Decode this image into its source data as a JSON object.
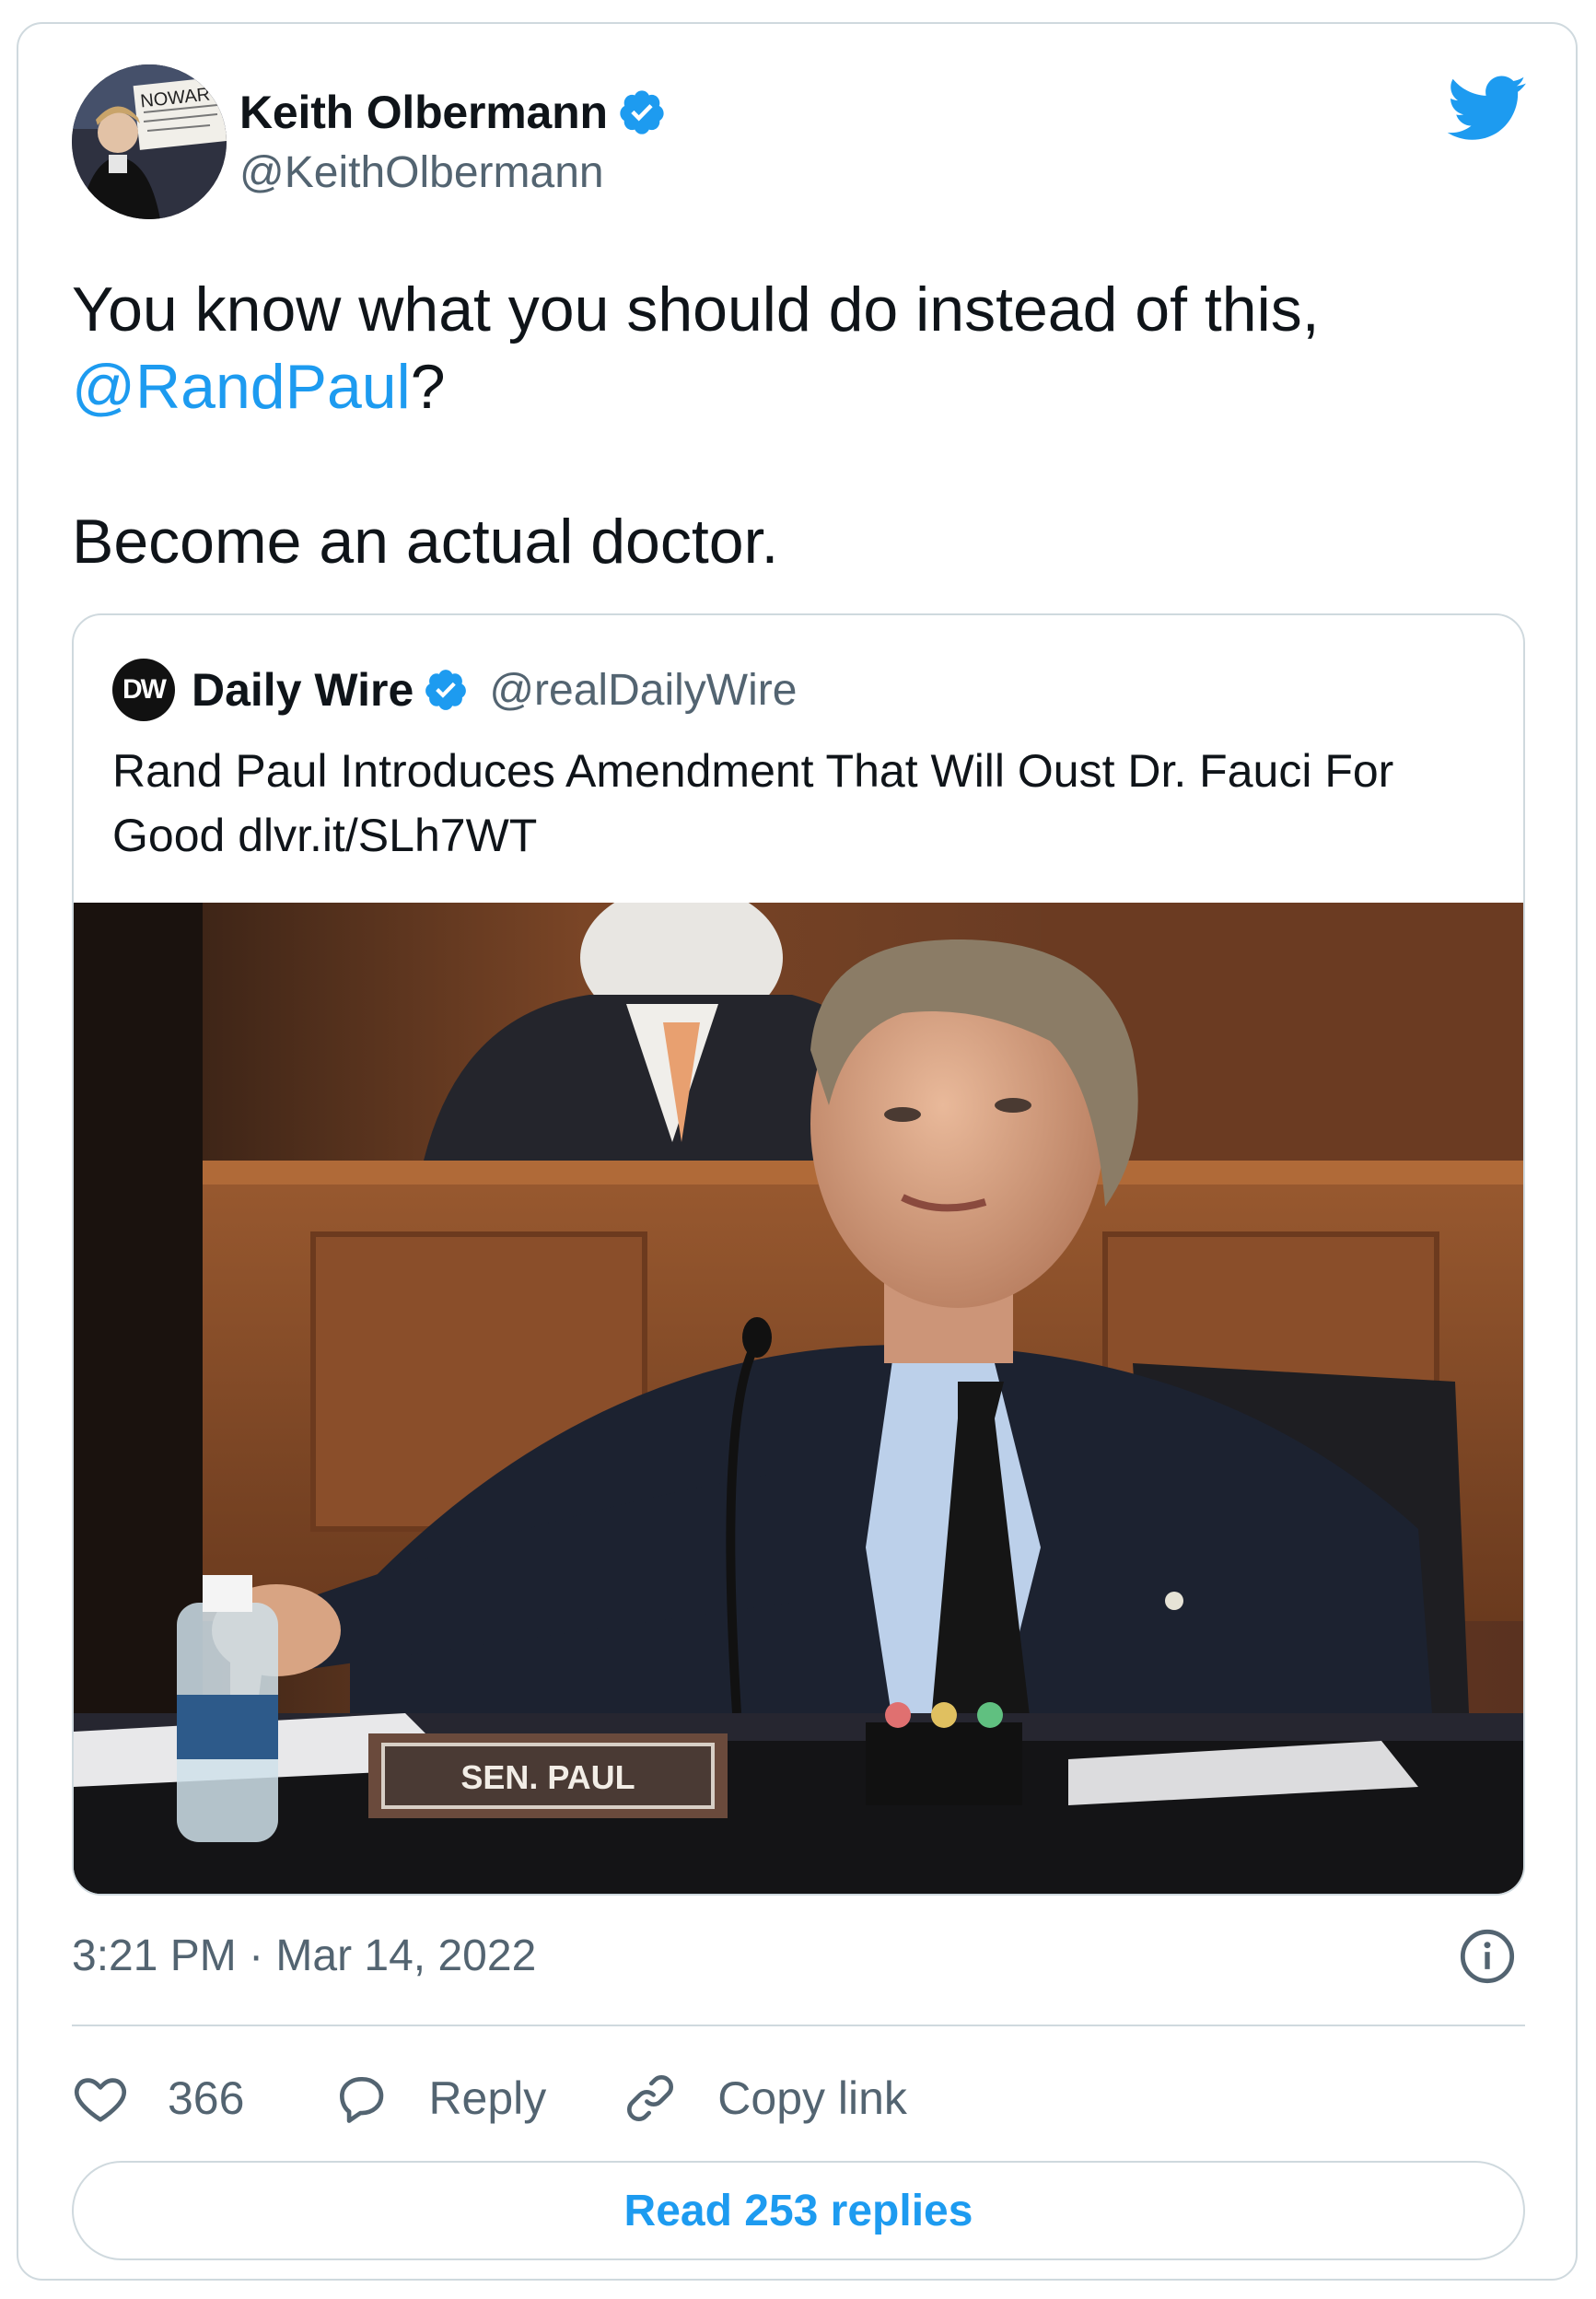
{
  "author": {
    "name": "Keith Olbermann",
    "handle": "@KeithOlbermann",
    "avatar_sign_text": "NOWAR"
  },
  "tweet": {
    "line1": "You know what you should do instead of this,",
    "mention": "@RandPaul",
    "mention_suffix": "?",
    "line3": "Become an actual doctor."
  },
  "quote": {
    "logo_text": "DW",
    "name": "Daily Wire",
    "handle": "@realDailyWire",
    "text": "Rand Paul Introduces Amendment That Will Oust Dr. Fauci For Good dlvr.it/SLh7WT",
    "image": {
      "nameplate": "SEN. PAUL"
    }
  },
  "footer": {
    "timestamp": "3:21 PM · Mar 14, 2022",
    "like_count": "366",
    "reply_label": "Reply",
    "copy_label": "Copy link",
    "read_replies": "Read 253 replies"
  },
  "colors": {
    "accent": "#1d9bf0",
    "text": "#0f1419",
    "muted": "#536471",
    "border": "#cfd9de"
  },
  "icons": [
    "twitter-bird-icon",
    "verified-badge-icon",
    "info-icon",
    "heart-icon",
    "reply-bubble-icon",
    "link-icon"
  ]
}
